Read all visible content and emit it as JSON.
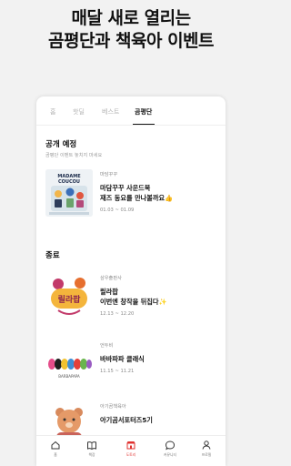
{
  "headline": {
    "line1": "매달 새로 열리는",
    "line2": "곰평단과 책육아 이벤트"
  },
  "tabs": [
    {
      "label": "홈",
      "active": false
    },
    {
      "label": "핫딜",
      "active": false
    },
    {
      "label": "베스트",
      "active": false
    },
    {
      "label": "곰평단",
      "active": true
    }
  ],
  "upcoming": {
    "title": "공개 예정",
    "subtitle": "곰평단 이벤트 놓치지 마세요",
    "items": [
      {
        "publisher": "마담꾸꾸",
        "title_line1": "마담꾸꾸 사운드북",
        "title_line2": "재즈 동요를 만나볼까요👍",
        "dates": "01.03 ~ 01.09",
        "cover_text1": "MADAME",
        "cover_text2": "COUCOU"
      }
    ]
  },
  "ended": {
    "title": "종료",
    "items": [
      {
        "publisher": "삼우출판사",
        "title_line1": "릴라팝",
        "title_line2": "이번엔 창작을 뒤집다✨",
        "dates": "12.13 ~ 12.20",
        "cover_text": "릴라팝"
      },
      {
        "publisher": "언두비",
        "title_line1": "바바파파 클래식",
        "title_line2": "",
        "dates": "11.15 ~ 11.21",
        "cover_text": "BARBAPAPA"
      },
      {
        "publisher": "아기곰책육아",
        "title_line1": "아기곰서포터즈5기",
        "title_line2": "",
        "dates": "",
        "cover_text": ""
      }
    ]
  },
  "bottom_nav": [
    {
      "label": "홈",
      "icon": "home-icon",
      "active": false
    },
    {
      "label": "책장",
      "icon": "book-icon",
      "active": false
    },
    {
      "label": "도토리",
      "icon": "store-icon",
      "active": true
    },
    {
      "label": "커뮤니티",
      "icon": "chat-icon",
      "active": false
    },
    {
      "label": "프로필",
      "icon": "profile-icon",
      "active": false
    }
  ],
  "colors": {
    "accent": "#e0322f",
    "madame_bg": "#e7eef2",
    "lilapop_bg": "#ffffff"
  }
}
